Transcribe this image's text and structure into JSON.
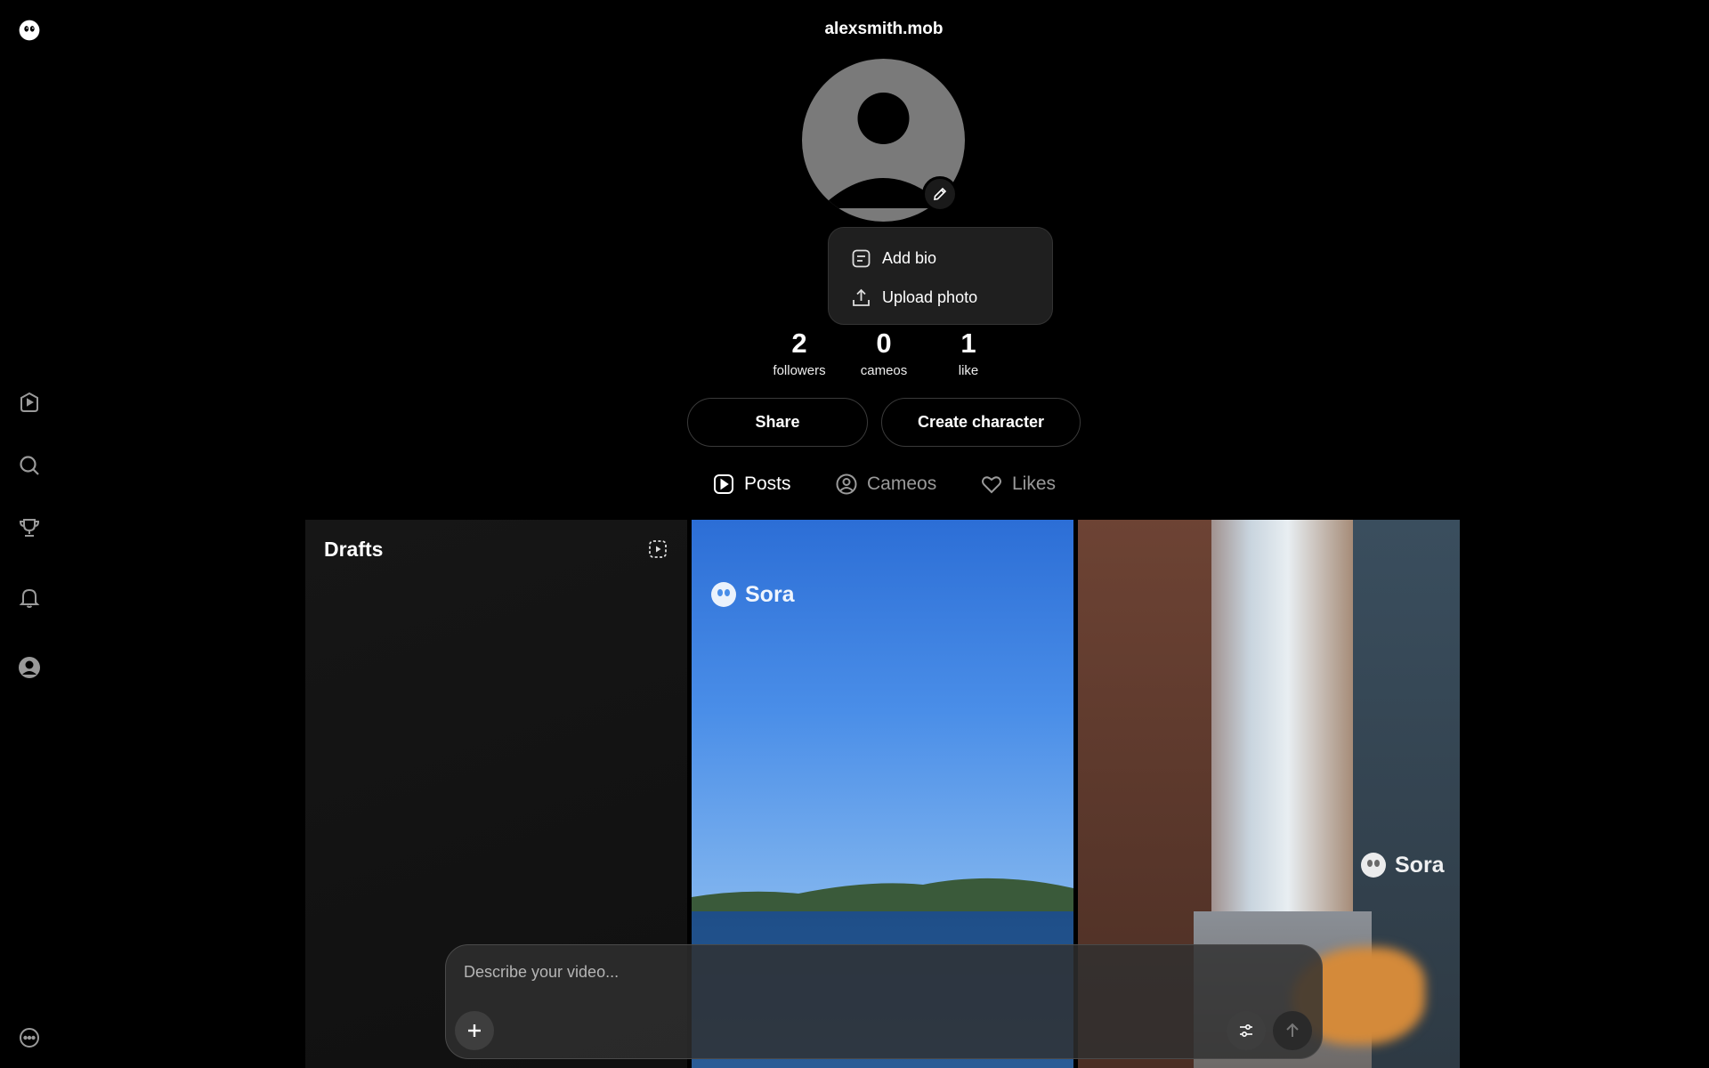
{
  "header": {
    "username": "alexsmith.mob"
  },
  "menu": {
    "items": [
      {
        "label": "Add bio",
        "icon": "bio-icon"
      },
      {
        "label": "Upload photo",
        "icon": "upload-icon"
      }
    ]
  },
  "stats": [
    {
      "value": "2",
      "label": "followers"
    },
    {
      "value": "0",
      "label": "cameos"
    },
    {
      "value": "1",
      "label": "like"
    }
  ],
  "actions": {
    "share_label": "Share",
    "create_label": "Create character"
  },
  "tabs": [
    {
      "label": "Posts",
      "icon": "play-square-icon",
      "active": true
    },
    {
      "label": "Cameos",
      "icon": "person-circle-icon",
      "active": false
    },
    {
      "label": "Likes",
      "icon": "heart-icon",
      "active": false
    }
  ],
  "grid": {
    "drafts_title": "Drafts",
    "watermark": "Sora"
  },
  "composer": {
    "placeholder": "Describe your video..."
  },
  "sidebar": {
    "items": [
      "logo-icon",
      "feed-icon",
      "search-icon",
      "trophy-icon",
      "bell-icon",
      "profile-icon",
      "more-icon"
    ]
  }
}
